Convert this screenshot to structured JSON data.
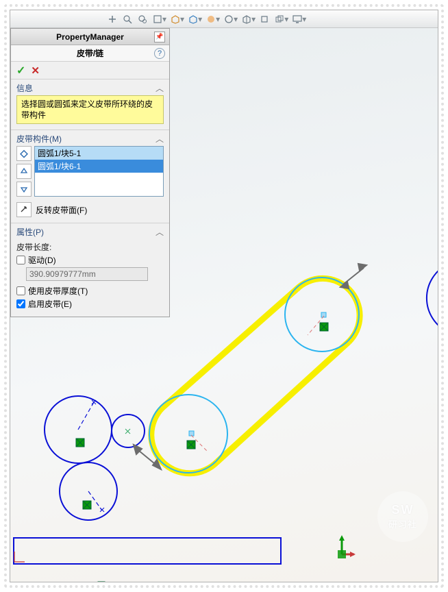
{
  "pm": {
    "title": "PropertyManager",
    "feature": "皮带/链",
    "ok_tip": "确定",
    "cancel_tip": "取消"
  },
  "info": {
    "head": "信息",
    "text": "选择圆或圆弧来定义皮带所环绕的皮带构件"
  },
  "members": {
    "head": "皮带构件(M)",
    "items": [
      "圆弧1/块5-1",
      "圆弧1/块6-1"
    ],
    "flip": "反转皮带面(F)"
  },
  "props": {
    "head": "属性(P)",
    "len_label": "皮带长度:",
    "drive": "驱动(D)",
    "len_value": "390.90979777mm",
    "thickness": "使用皮带厚度(T)",
    "enable": "启用皮带(E)"
  },
  "toolbar_icons": [
    "zoom-fit-icon",
    "zoom-area-icon",
    "zoom-prev-icon",
    "section-icon",
    "display-style-icon",
    "hide-show-icon",
    "appearance-icon",
    "scene-icon",
    "view-settings-icon",
    "front-view-icon",
    "iso-view-icon",
    "normal-icon",
    "render-icon",
    "monitor-icon"
  ]
}
